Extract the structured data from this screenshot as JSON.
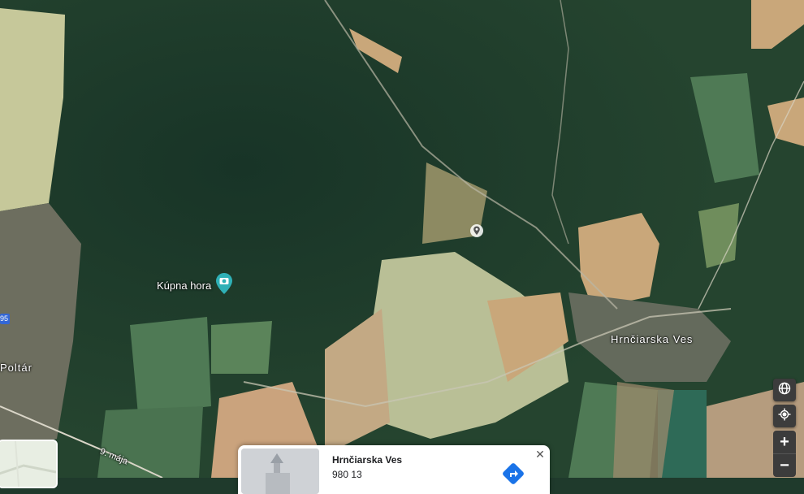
{
  "map": {
    "places": {
      "town_east": "Hrnčiarska Ves",
      "town_west": "Poltár",
      "hill": "Kúpna hora",
      "road_label": "9. mája",
      "road_number": "95"
    }
  },
  "place_card": {
    "title": "Hrnčiarska Ves",
    "subtitle": "980 13",
    "close_glyph": "✕"
  },
  "controls": {
    "zoom_in": "+",
    "zoom_out": "−"
  },
  "colors": {
    "forest": "#1f3a2c",
    "field_tan": "#c9a77a",
    "field_light": "#b9bf96",
    "meadow": "#4f7a55",
    "poi_teal": "#2fb0b6",
    "directions_blue": "#1a73e8"
  }
}
